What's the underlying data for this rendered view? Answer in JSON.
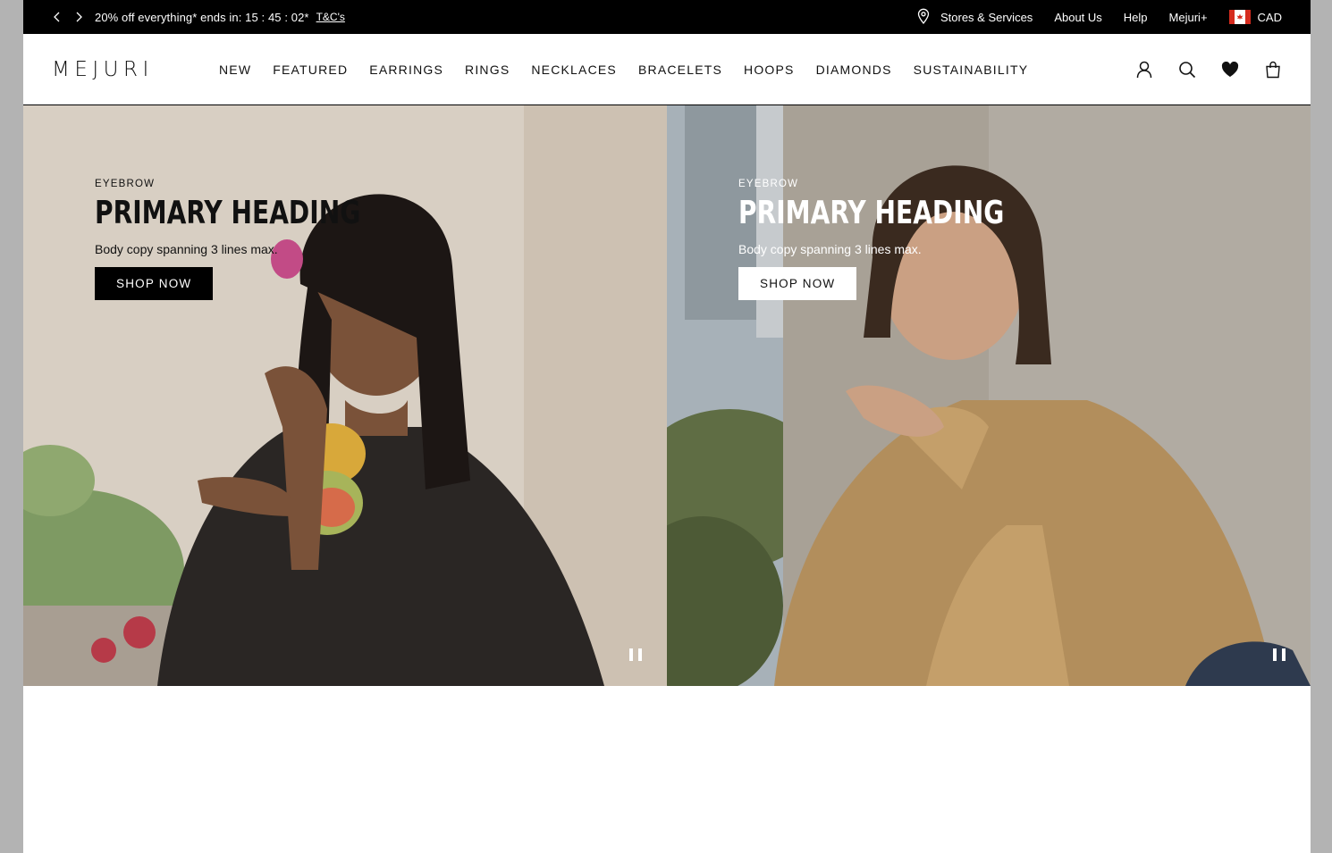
{
  "promo": {
    "message": "20% off everything* ends in: 15 : 45 : 02*",
    "terms_link": "T&C's",
    "links": {
      "stores": "Stores & Services",
      "about": "About Us",
      "help": "Help",
      "plus": "Mejuri+",
      "currency": "CAD"
    },
    "icons": {
      "prev": "chevron-left-icon",
      "next": "chevron-right-icon",
      "stores": "location-pin-icon",
      "flag": "canada-flag-icon"
    }
  },
  "nav": {
    "logo": "MEJURI",
    "items": [
      "NEW",
      "FEATURED",
      "EARRINGS",
      "RINGS",
      "NECKLACES",
      "BRACELETS",
      "HOOPS",
      "DIAMONDS",
      "SUSTAINABILITY"
    ],
    "icons": [
      "account-icon",
      "search-icon",
      "wishlist-heart-icon",
      "bag-icon"
    ]
  },
  "hero": {
    "left": {
      "eyebrow": "EYEBROW",
      "heading": "PRIMARY HEADING",
      "body": "Body copy spanning 3 lines max.",
      "cta": "SHOP NOW",
      "text_color": "#111111"
    },
    "right": {
      "eyebrow": "EYEBROW",
      "heading": "PRIMARY HEADING",
      "body": "Body copy spanning 3 lines max.",
      "cta": "SHOP NOW",
      "text_color": "#ffffff"
    }
  },
  "colors": {
    "promo_bg": "#000000",
    "page_bg": "#ffffff",
    "outer_bg": "#b3b3b3"
  }
}
